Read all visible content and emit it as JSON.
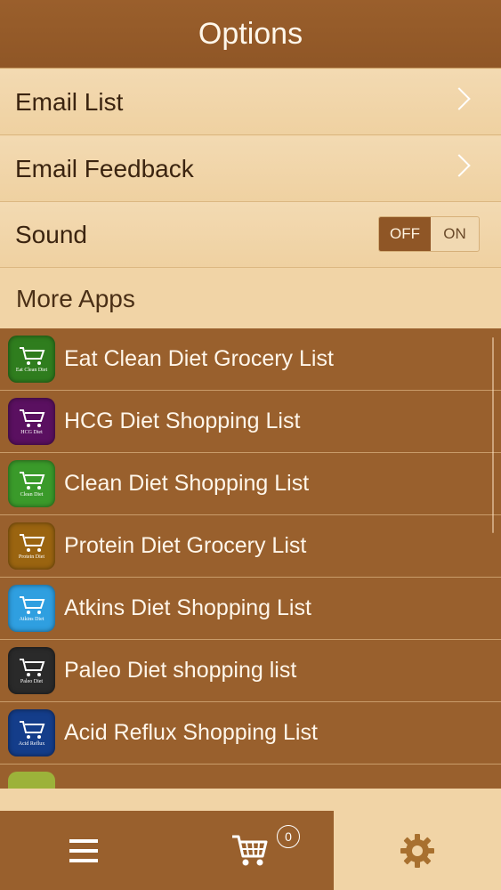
{
  "header": {
    "title": "Options"
  },
  "options": {
    "email_list": "Email List",
    "email_feedback": "Email Feedback",
    "sound": {
      "label": "Sound",
      "off_label": "OFF",
      "on_label": "ON",
      "selected": "OFF"
    }
  },
  "more_apps": {
    "title": "More Apps",
    "items": [
      {
        "name": "Eat Clean Diet Grocery List",
        "icon_caption": "Eat Clean Diet",
        "icon_color": "#2f7d1e"
      },
      {
        "name": "HCG Diet Shopping List",
        "icon_caption": "HCG Diet",
        "icon_color": "#5a1060"
      },
      {
        "name": "Clean Diet Shopping List",
        "icon_caption": "Clean Diet",
        "icon_color": "#3a9a2a"
      },
      {
        "name": "Protein Diet Grocery List",
        "icon_caption": "Protein Diet",
        "icon_color": "#9a6410"
      },
      {
        "name": "Atkins Diet Shopping List",
        "icon_caption": "Atkins Diet",
        "icon_color": "#2f9fe0"
      },
      {
        "name": "Paleo Diet shopping list",
        "icon_caption": "Paleo Diet",
        "icon_color": "#2a2a2a"
      },
      {
        "name": "Acid Reflux Shopping List",
        "icon_caption": "Acid Reflux",
        "icon_color": "#143d8a"
      }
    ]
  },
  "tabbar": {
    "cart_count": "0",
    "icons": [
      "menu-icon",
      "cart-icon",
      "gear-icon"
    ]
  },
  "colors": {
    "header_bg": "#8f5626",
    "list_bg": "#99602d",
    "option_bg": "#f1d4a6",
    "toggle_active": "#8f5626"
  }
}
